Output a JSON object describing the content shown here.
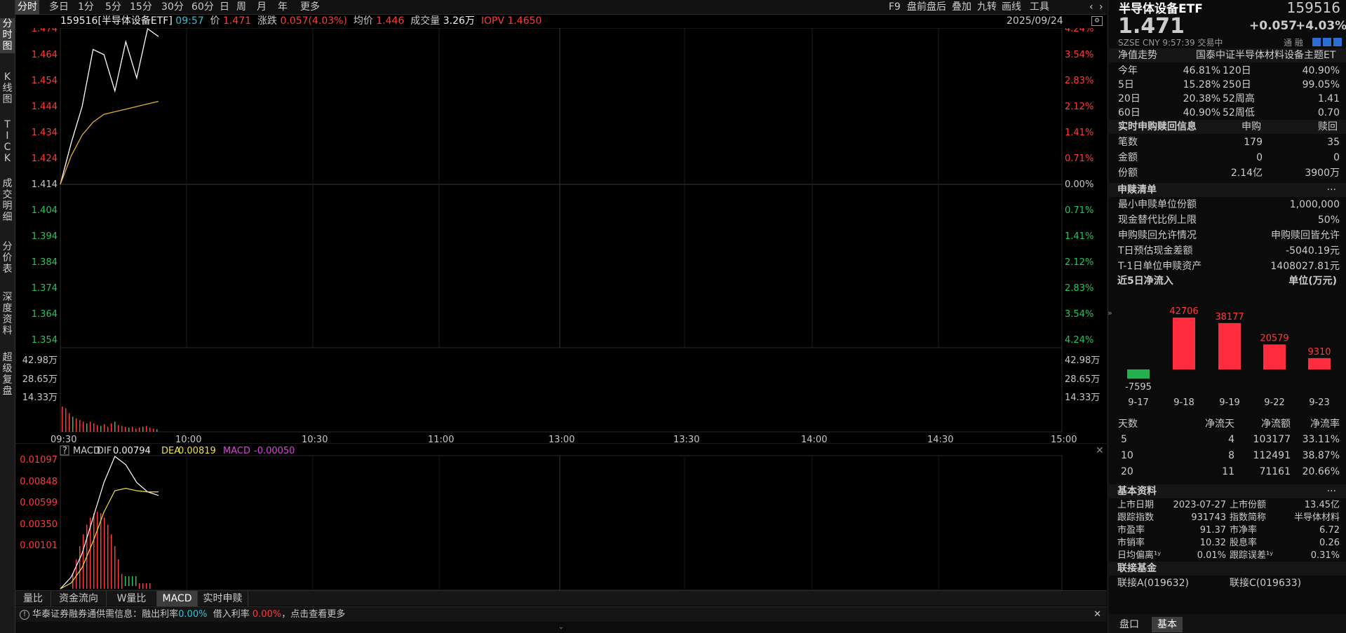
{
  "left_tabs": [
    "分时图",
    "K线图",
    "TICK",
    "成交明细",
    "分价表",
    "深度资料",
    "超级复盘"
  ],
  "periods": [
    "分时",
    "多日",
    "1分",
    "5分",
    "15分",
    "30分",
    "60分",
    "日",
    "周",
    "月",
    "年",
    "更多"
  ],
  "right_tools": [
    "F9",
    "盘前盘后",
    "叠加",
    "九转",
    "画线",
    "工具"
  ],
  "info": {
    "code_name": "159516[半导体设备ETF]",
    "time": "09:57",
    "price_label": "价",
    "price": "1.471",
    "chg_label": "涨跌",
    "chg": "0.057(4.03%)",
    "avg_label": "均价",
    "avg": "1.446",
    "vol_label": "成交量",
    "vol": "3.26万",
    "iopv_label": "IOPV",
    "iopv": "1.4650",
    "date": "2025/09/24"
  },
  "price_axis": {
    "left": [
      "1.474",
      "1.464",
      "1.454",
      "1.444",
      "1.434",
      "1.424",
      "1.414",
      "1.404",
      "1.394",
      "1.384",
      "1.374",
      "1.364",
      "1.354"
    ],
    "right": [
      "4.24%",
      "3.54%",
      "2.83%",
      "2.12%",
      "1.41%",
      "0.71%",
      "0.00%",
      "0.71%",
      "1.41%",
      "2.12%",
      "2.83%",
      "3.54%",
      "4.24%"
    ]
  },
  "vol_axis": [
    "42.98万",
    "28.65万",
    "14.33万"
  ],
  "time_axis": [
    "09:30",
    "10:00",
    "10:30",
    "11:00",
    "13:00",
    "13:30",
    "14:00",
    "14:30",
    "15:00"
  ],
  "macd": {
    "q": "?",
    "title": "MACD",
    "dif_label": "DIF",
    "dif": "0.00794",
    "dea_label": "DEA",
    "dea": "0.00819",
    "macd_label": "MACD",
    "macd": "-0.00050",
    "axis": [
      "0.01097",
      "0.00848",
      "0.00599",
      "0.00350",
      "0.00101"
    ]
  },
  "bottom_tabs": [
    "量比",
    "资金流向",
    "W量比",
    "MACD",
    "实时申赎"
  ],
  "notice": {
    "text": "华泰证券融券通供需信息：融出利率",
    "rate1": "0.00%",
    "text2": "借入利率",
    "rate2": "0.00%",
    "text3": "，点击查看更多"
  },
  "rp": {
    "name": "半导体设备ETF",
    "code": "159516",
    "price": "1.471",
    "chg": "+0.057",
    "pct": "+4.03%",
    "meta": "SZSE  CNY  9:57:39  交易中",
    "icons_text": "通 融",
    "nav_label": "净值走势",
    "index_name": "国泰中证半导体材料设备主题ET",
    "perf": [
      [
        "今年",
        "46.81%",
        "120日",
        "40.90%"
      ],
      [
        "5日",
        "15.28%",
        "250日",
        "99.05%"
      ],
      [
        "20日",
        "20.38%",
        "52周高",
        "1.41"
      ],
      [
        "60日",
        "40.90%",
        "52周低",
        "0.70"
      ]
    ],
    "sg": {
      "title": "实时申购赎回信息",
      "h1": "申购",
      "h2": "赎回",
      "rows": [
        [
          "笔数",
          "179",
          "35"
        ],
        [
          "金额",
          "0",
          "0"
        ],
        [
          "份额",
          "2.14亿",
          "3900万"
        ]
      ]
    },
    "sgqd": {
      "title": "申赎清单",
      "more": "···",
      "rows": [
        [
          "最小申赎单位份额",
          "1,000,000"
        ],
        [
          "现金替代比例上限",
          "50%"
        ],
        [
          "申购赎回允许情况",
          "申购赎回皆允许"
        ],
        [
          "T日预估现金差额",
          "-5040.19元"
        ],
        [
          "T-1日单位申赎资产",
          "1408027.81元"
        ]
      ]
    },
    "flow": {
      "title": "近5日净流入",
      "unit": "单位(万元)",
      "dates": [
        "9-17",
        "9-18",
        "9-19",
        "9-22",
        "9-23"
      ],
      "values": [
        -7595,
        42706,
        38177,
        20579,
        9310
      ]
    },
    "flow_table": {
      "headers": [
        "天数",
        "净流天",
        "净流额",
        "净流率"
      ],
      "rows": [
        [
          "5",
          "4",
          "103177",
          "33.11%"
        ],
        [
          "10",
          "8",
          "112491",
          "38.87%"
        ],
        [
          "20",
          "11",
          "71161",
          "20.66%"
        ]
      ]
    },
    "basic": {
      "title": "基本资料",
      "more": "···",
      "rows": [
        [
          "上市日期",
          "2023-07-27",
          "上市份额",
          "13.45亿"
        ],
        [
          "跟踪指数",
          "931743",
          "指数简称",
          "半导体材料"
        ],
        [
          "市盈率",
          "91.37",
          "市净率",
          "6.72"
        ],
        [
          "市销率",
          "10.32",
          "股息率",
          "0.26"
        ],
        [
          "日均偏离¹ʸ",
          "0.01%",
          "跟踪误差¹ʸ",
          "0.31%"
        ]
      ]
    },
    "link": {
      "title": "联接基金",
      "a": "联接A(019632)",
      "c": "联接C(019633)"
    },
    "tabs": [
      "盘口",
      "基本"
    ]
  },
  "chart_data": {
    "type": "line",
    "x": [
      "09:30",
      "09:33",
      "09:36",
      "09:39",
      "09:42",
      "09:45",
      "09:48",
      "09:51",
      "09:54",
      "09:57"
    ],
    "series": [
      {
        "values": [
          1.414,
          1.43,
          1.444,
          1.466,
          1.464,
          1.45,
          1.469,
          1.455,
          1.474,
          1.471
        ]
      },
      {
        "values": [
          1.414,
          1.425,
          1.433,
          1.438,
          1.441,
          1.442,
          1.443,
          1.444,
          1.445,
          1.446
        ]
      }
    ],
    "volume": [
      30,
      28,
      22,
      18,
      16,
      14,
      12,
      10,
      12,
      10,
      8,
      7,
      9,
      6,
      10,
      12,
      8,
      7,
      6,
      5,
      6,
      4,
      5,
      6,
      7,
      5,
      4,
      3
    ],
    "macd_dif": [
      0.0,
      0.001,
      0.003,
      0.006,
      0.009,
      0.0112,
      0.0105,
      0.009,
      0.0082,
      0.0079
    ],
    "macd_dea": [
      0.0,
      0.0005,
      0.0018,
      0.004,
      0.0065,
      0.0083,
      0.0085,
      0.0083,
      0.0082,
      0.0082
    ],
    "ylim": [
      1.354,
      1.474
    ]
  }
}
